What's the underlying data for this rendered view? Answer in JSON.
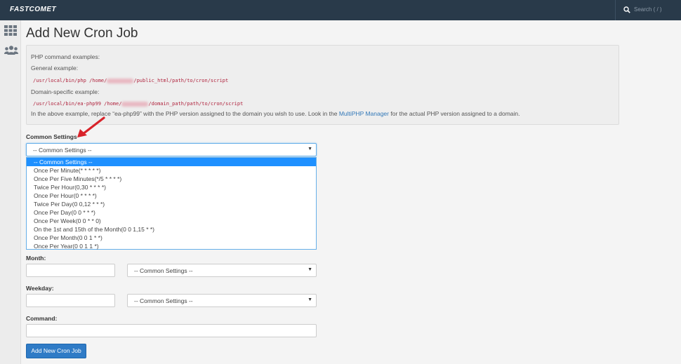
{
  "header": {
    "logo": "FASTCOMET",
    "search_placeholder": "Search ( / )"
  },
  "sidenav": {
    "icons": [
      "grid-icon",
      "users-icon"
    ]
  },
  "page": {
    "title": "Add New Cron Job"
  },
  "info": {
    "php_examples_label": "PHP command examples:",
    "general_label": "General example:",
    "general_code_a": "/usr/local/bin/php /home/",
    "general_code_b": "/public_html/path/to/cron/script",
    "domain_label": "Domain-specific example:",
    "domain_code_a": "/usr/local/bin/ea-php99 /home/",
    "domain_code_b": "/domain_path/path/to/cron/script",
    "note_a": "In the above example, replace “ea-php99” with the PHP version assigned to the domain you wish to use. Look in the ",
    "note_link": "MultiPHP Manager",
    "note_b": " for the actual PHP version assigned to a domain."
  },
  "common_settings": {
    "label": "Common Settings",
    "selected": "-- Common Settings --",
    "options": [
      "-- Common Settings --",
      "Once Per Minute(* * * * *)",
      "Once Per Five Minutes(*/5 * * * *)",
      "Twice Per Hour(0,30 * * * *)",
      "Once Per Hour(0 * * * *)",
      "Twice Per Day(0 0,12 * * *)",
      "Once Per Day(0 0 * * *)",
      "Once Per Week(0 0 * * 0)",
      "On the 1st and 15th of the Month(0 0 1,15 * *)",
      "Once Per Month(0 0 1 * *)",
      "Once Per Year(0 0 1 1 *)"
    ]
  },
  "month": {
    "label": "Month:",
    "value": "",
    "select": "-- Common Settings --"
  },
  "weekday": {
    "label": "Weekday:",
    "value": "",
    "select": "-- Common Settings --"
  },
  "command": {
    "label": "Command:",
    "value": ""
  },
  "submit_label": "Add New Cron Job",
  "colors": {
    "topbar": "#293a4a",
    "accent": "#2f7bc6",
    "highlight": "#1e90ff",
    "code": "#b0233d",
    "arrow": "#d8232a"
  }
}
